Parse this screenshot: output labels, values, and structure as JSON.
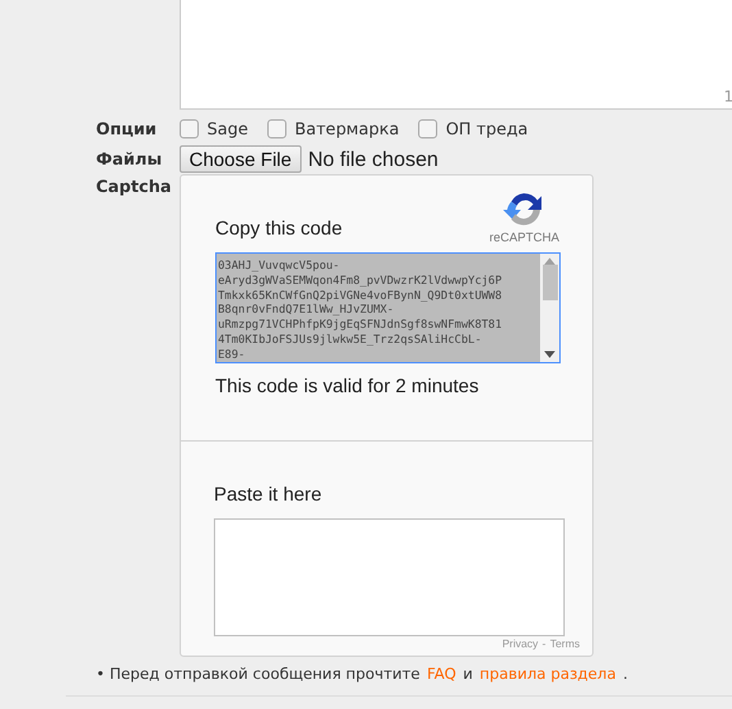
{
  "message": {
    "counter": "1"
  },
  "options": {
    "label": "Опции",
    "items": [
      {
        "label": "Sage",
        "checked": false
      },
      {
        "label": "Ватермарка",
        "checked": false
      },
      {
        "label": "ОП треда",
        "checked": false
      }
    ]
  },
  "files": {
    "label": "Файлы",
    "button": "Choose File",
    "status": "No file chosen"
  },
  "captcha": {
    "label": "Captcha",
    "heading": "Copy this code",
    "brand": "reCAPTCHA",
    "code_lines": [
      "03AHJ_VuvqwcV5pou-",
      "eAryd3gWVaSEMWqon4Fm8_pvVDwzrK2lVdwwpYcj6P",
      "Tmkxk65KnCWfGnQ2piVGNe4voFBynN_Q9Dt0xtUWW8",
      "B8qnr0vFndQ7E1lWw_HJvZUMX-",
      "uRmzpg71VCHPhfpK9jgEqSFNJdnSgf8swNFmwK8T81",
      "4Tm0KIbJoFSJUs9jlwkw5E_Trz2qsSAliHcCbL-",
      "E89-"
    ],
    "validity": "This code is valid for 2 minutes",
    "paste_label": "Paste it here",
    "privacy": "Privacy",
    "separator": "-",
    "terms": "Terms"
  },
  "notice": [
    {
      "kind": "text",
      "text": "• Перед отправкой сообщения прочтите"
    },
    {
      "kind": "link",
      "text": "FAQ"
    },
    {
      "kind": "text",
      "text": "и"
    },
    {
      "kind": "link",
      "text": "правила раздела"
    },
    {
      "kind": "text",
      "text": "."
    }
  ]
}
